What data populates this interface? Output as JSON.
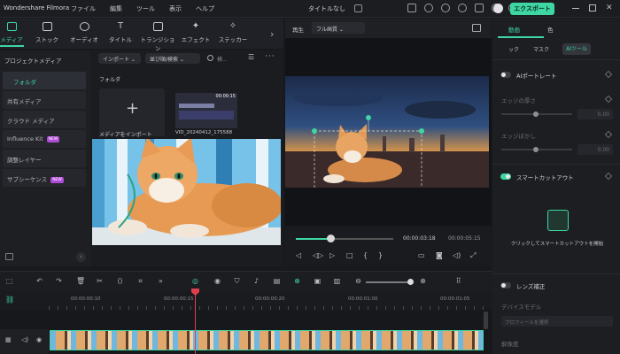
{
  "titlebar": {
    "app_name": "Wondershare Filmora",
    "menu": [
      "ファイル",
      "編集",
      "ツール",
      "表示",
      "ヘルプ"
    ],
    "doc_title": "タイトルなし",
    "export_label": "エクスポート"
  },
  "media_tabs": [
    "メディア",
    "ストック",
    "オーディオ",
    "タイトル",
    "トランジション",
    "エフェクト",
    "ステッカー"
  ],
  "sidebar": {
    "header": "プロジェクトメディア",
    "items": [
      {
        "label": "フォルダ"
      },
      {
        "label": "共有メディア"
      },
      {
        "label": "クラウド メディア"
      },
      {
        "label": "Influence Kit",
        "badge": "NEW"
      },
      {
        "label": "調整レイヤー"
      },
      {
        "label": "サブシーケンス",
        "badge": "NEW"
      }
    ]
  },
  "media": {
    "import_filter": "インポート",
    "sort_filter": "並び順/検索",
    "search_placeholder": "検...",
    "folder_label": "フォルダ",
    "import_tile_label": "メディアをインポート",
    "video_name": "VID_20240412_175588",
    "video_duration": "00:00:15"
  },
  "preview": {
    "label": "再生",
    "quality": "フル画質",
    "timecode_current": "00:00:03:18",
    "timecode_total": "00:00:05:15",
    "progress": 0.35
  },
  "props": {
    "tabs_top": [
      "動画",
      "色"
    ],
    "tabs_sub": [
      "ック",
      "マスク",
      "AIツール"
    ],
    "ai_portrait_label": "AIポートレート",
    "edge_label": "エッジの厚さ",
    "edge_value": "0.00",
    "feather_label": "エッジぼかし",
    "feather_value": "0.00",
    "smart_cutout_label": "スマートカットアウト",
    "smart_caption": "クリックしてスマートカットアウトを開始",
    "lens_label": "レンズ補正",
    "device_label": "デバイスモデル",
    "device_placeholder": "プロフィールを選択",
    "resolution_label": "解像度"
  },
  "timeline": {
    "ticks": [
      "00:00:00:10",
      "00:00:00:15",
      "00:00:00:20",
      "00:00:01:00",
      "00:00:01:05"
    ]
  },
  "colors": {
    "accent": "#3ed6a3",
    "playhead": "#e0404e"
  }
}
